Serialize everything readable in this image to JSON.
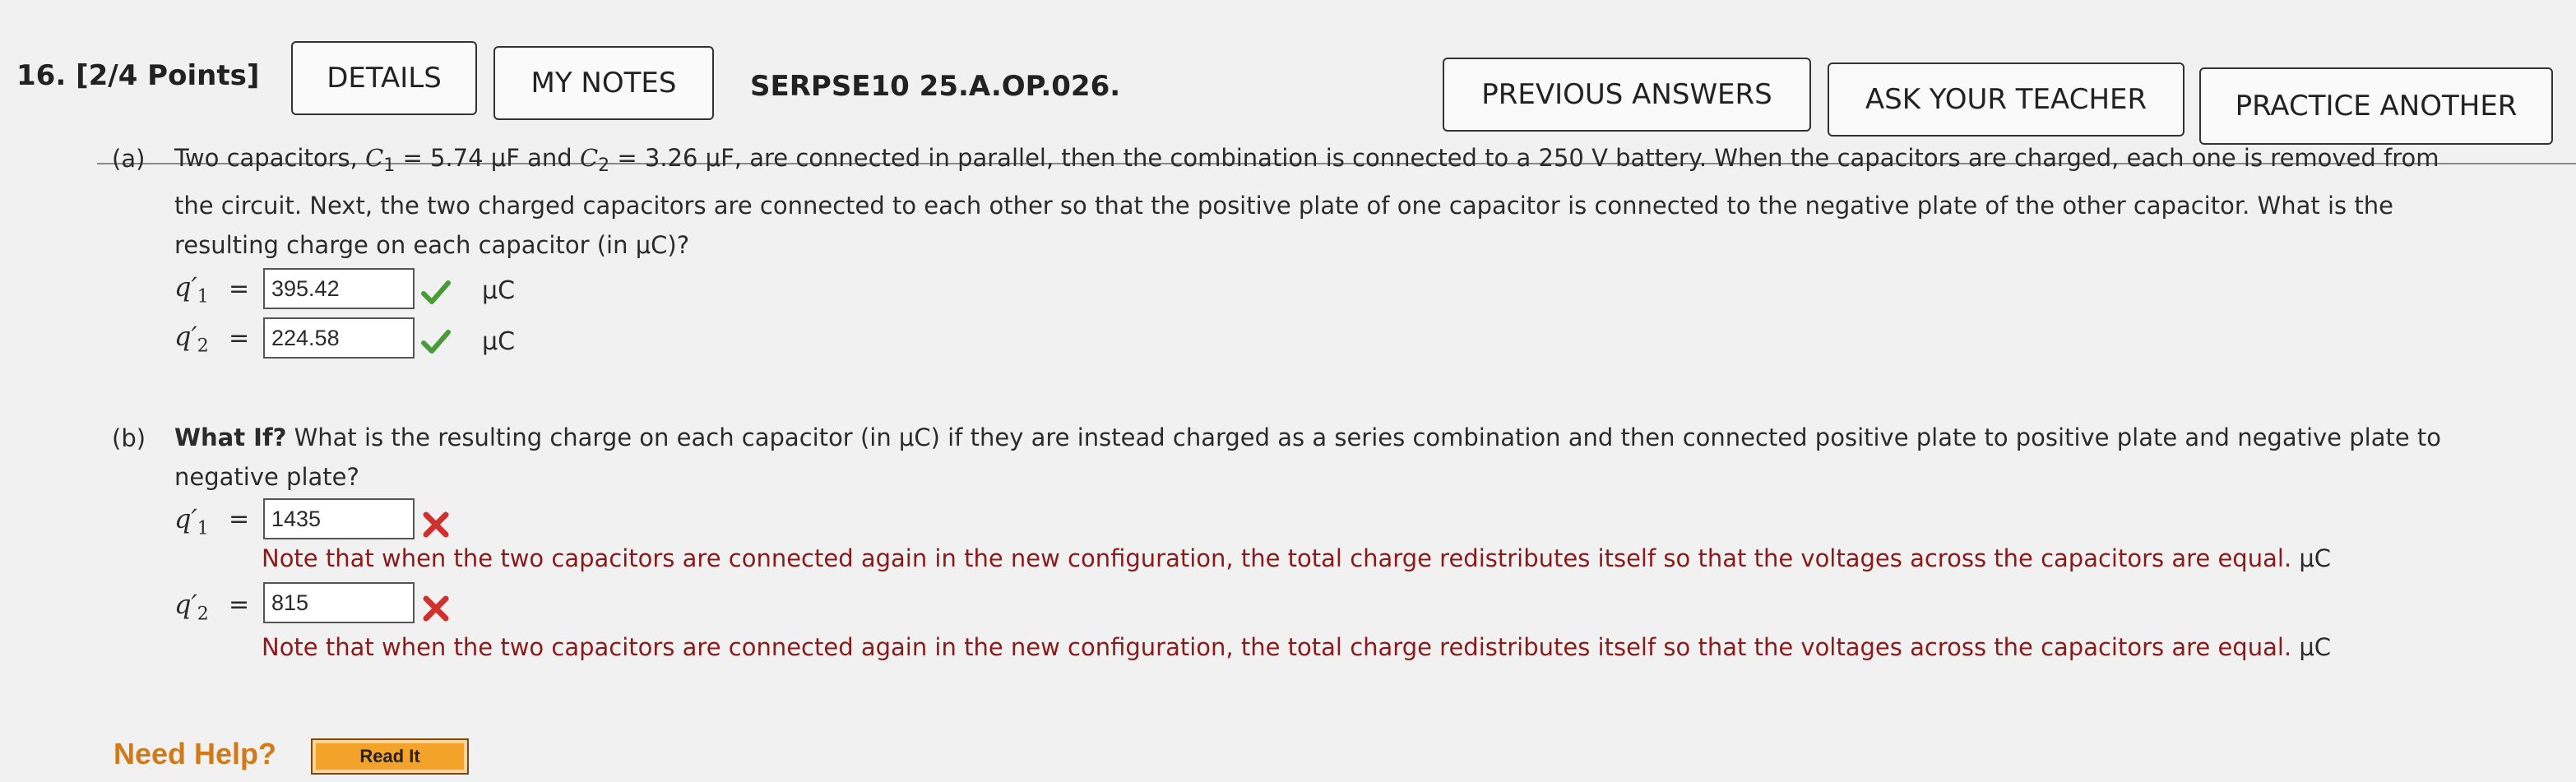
{
  "header": {
    "question_number": "16.",
    "points": "[2/4 Points]",
    "details_label": "DETAILS",
    "my_notes_label": "MY NOTES",
    "problem_id": "SERPSE10 25.A.OP.026.",
    "previous_answers_label": "PREVIOUS ANSWERS",
    "ask_teacher_label": "ASK YOUR TEACHER",
    "practice_another_label": "PRACTICE ANOTHER"
  },
  "part_a": {
    "label": "(a)",
    "text_prefix": "Two capacitors, ",
    "c1_symbol": "C",
    "c1_sub": "1",
    "c1_value": " = 5.74 μF and ",
    "c2_symbol": "C",
    "c2_sub": "2",
    "c2_value": " = 3.26 μF, are connected in parallel, then the combination is connected to a 250 V battery. When the capacitors are charged, each one is removed from",
    "line2": "the circuit. Next, the two charged capacitors are connected to each other so that the positive plate of one capacitor is connected to the negative plate of the other capacitor. What is the",
    "line3": "resulting charge on each capacitor (in μC)?",
    "q1_label": "q′",
    "q1_sub": "1",
    "q1_value": "395.42",
    "q1_unit": "μC",
    "q2_label": "q′",
    "q2_sub": "2",
    "q2_value": "224.58",
    "q2_unit": "μC",
    "equals": "="
  },
  "part_b": {
    "label": "(b)",
    "bold_prefix": "What If?",
    "line1": " What is the resulting charge on each capacitor (in μC) if they are instead charged as a series combination and then connected positive plate to positive plate and negative plate to",
    "line2": "negative plate?",
    "q1_label": "q′",
    "q1_sub": "1",
    "q1_value": "1435",
    "q1_note": "Note that when the two capacitors are connected again in the new configuration, the total charge redistributes itself so that the voltages across the capacitors are equal.",
    "q1_unit": "μC",
    "q2_label": "q′",
    "q2_sub": "2",
    "q2_value": "815",
    "q2_note": "Note that when the two capacitors are connected again in the new configuration, the total charge redistributes itself so that the voltages across the capacitors are equal.",
    "q2_unit": "μC",
    "equals": "="
  },
  "help": {
    "need_help_label": "Need Help?",
    "read_it_label": "Read It"
  },
  "colors": {
    "correct": "#4a9a3a",
    "incorrect": "#d0312d",
    "note_text": "#8b1a1a",
    "help_text": "#d07a1a",
    "read_it_bg": "#f3a32a"
  }
}
